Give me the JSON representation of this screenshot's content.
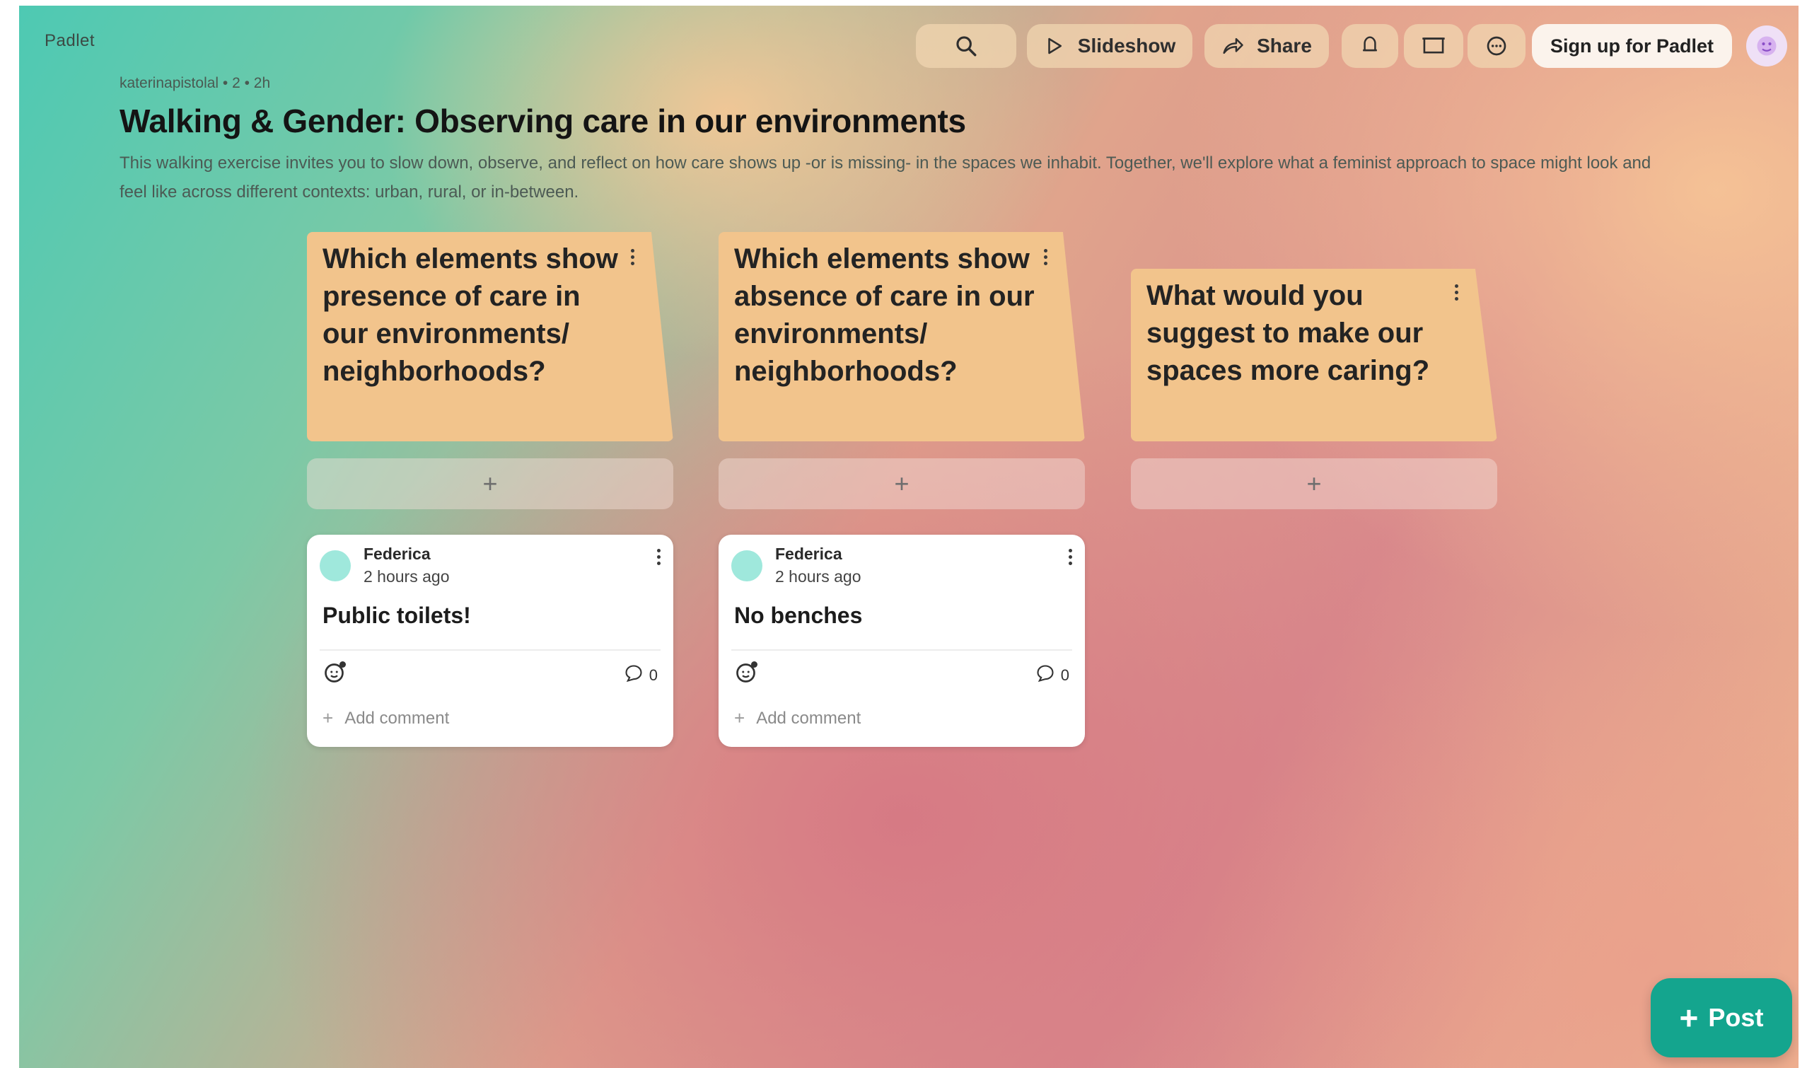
{
  "app": {
    "logo": "Padlet"
  },
  "toolbar": {
    "slideshow_label": "Slideshow",
    "share_label": "Share",
    "signup_label": "Sign up for Padlet"
  },
  "board": {
    "meta": "katerinapistolal • 2 • 2h",
    "title": "Walking & Gender: Observing care in our environments",
    "description": "This walking exercise invites you to slow down, observe, and reflect on how care shows up -or is missing- in the spaces we inhabit. Together, we'll explore what a feminist approach to space might look and feel like across different contexts: urban, rural, or in-between."
  },
  "columns": [
    {
      "title": "Which elements show presence of care in our environments/ neighborhoods?",
      "add_label": "+",
      "posts": [
        {
          "author": "Federica",
          "time": "2 hours ago",
          "body": "Public toilets!",
          "comments": "0",
          "add_comment": "Add comment"
        }
      ]
    },
    {
      "title": "Which elements show absence of care in our environments/ neighborhoods?",
      "add_label": "+",
      "posts": [
        {
          "author": "Federica",
          "time": "2 hours ago",
          "body": "No benches",
          "comments": "0",
          "add_comment": "Add comment"
        }
      ]
    },
    {
      "title": "What would you suggest to make our spaces more caring?",
      "add_label": "+",
      "posts": []
    }
  ],
  "post_button": {
    "plus": "+",
    "label": "Post"
  },
  "icons": {
    "search": "search-icon",
    "slideshow": "play-icon",
    "share": "share-arrow-icon",
    "notifications": "bell-icon",
    "device": "screen-icon",
    "more": "more-icon",
    "avatar": "user-avatar-icon",
    "reaction": "add-reaction-icon",
    "comment": "comment-icon"
  },
  "colors": {
    "accent": "#14a58e",
    "column_header": "#f2c48c",
    "card": "#ffffff",
    "avatar": "#9fe8dc"
  }
}
